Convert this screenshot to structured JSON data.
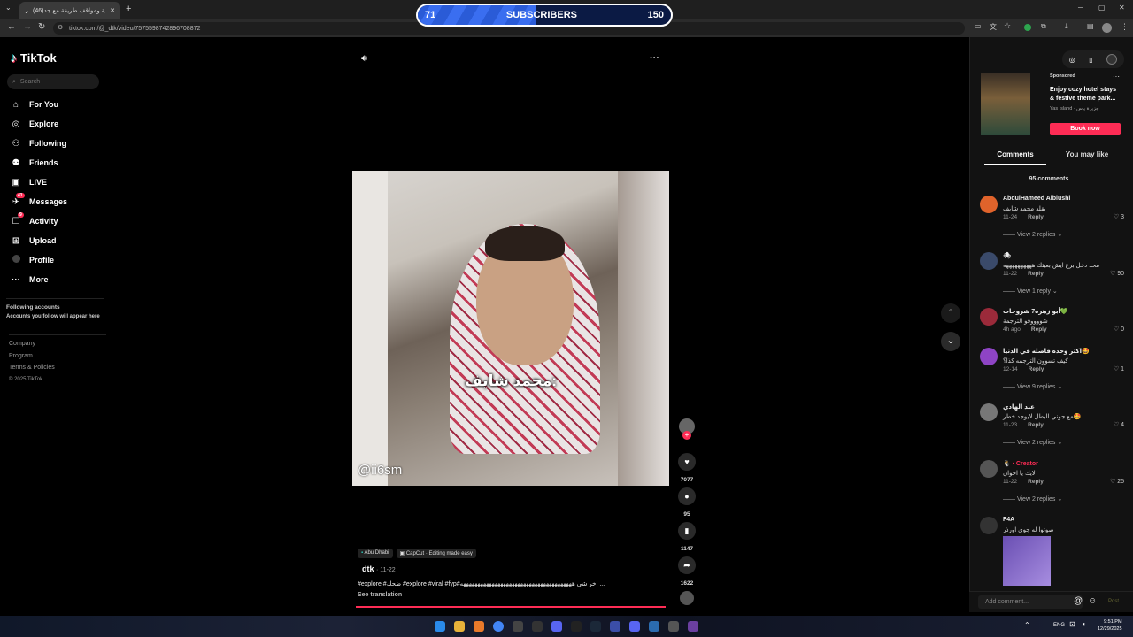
{
  "browser": {
    "tab_title": "(46)اقطاعية ومواقف طريقة مع جد...",
    "url": "tiktok.com/@_dtk/video/7575598742896708872",
    "new_tab": "+"
  },
  "overlay": {
    "left_count": "71",
    "label": "SUBSCRIBERS",
    "right_count": "150",
    "progress_fraction": 0.47
  },
  "sidebar": {
    "logo": "TikTok",
    "search_placeholder": "Search",
    "items": [
      {
        "label": "For You",
        "icon": "home-icon"
      },
      {
        "label": "Explore",
        "icon": "compass-icon"
      },
      {
        "label": "Following",
        "icon": "following-icon"
      },
      {
        "label": "Friends",
        "icon": "friends-icon"
      },
      {
        "label": "LIVE",
        "icon": "live-icon"
      },
      {
        "label": "Messages",
        "icon": "messages-icon",
        "badge": "41"
      },
      {
        "label": "Activity",
        "icon": "activity-icon",
        "badge": "9"
      },
      {
        "label": "Upload",
        "icon": "upload-icon"
      },
      {
        "label": "Profile",
        "icon": "avatar"
      },
      {
        "label": "More",
        "icon": "more-icon"
      }
    ],
    "following_title": "Following accounts",
    "following_sub": "Accounts you follow will appear here",
    "footer": [
      "Company",
      "Program",
      "Terms & Policies",
      "© 2025 TikTok"
    ]
  },
  "video": {
    "caption_overlay": "محمد شايف:",
    "watermark": "@ii6sm",
    "location_tag": "Abu Dhabi",
    "capcut_tag": "CapCut · Editing made easy",
    "author": "_dtk",
    "date": "· 11-22",
    "description": "#explore #ضحك #explore #viral #fyp#اخر شي هههههههههههههههههههههههههههههههههههههههه ...",
    "see_translation": "See translation"
  },
  "actions": {
    "likes": "7077",
    "comments": "95",
    "saves": "1147",
    "shares": "1622"
  },
  "right_panel": {
    "ad_label": "Sponsored",
    "ad_title": "Enjoy cozy hotel stays & festive theme park...",
    "ad_brand": "Yas Island · جزيرة ياس",
    "ad_button": "Book now",
    "tab_comments": "Comments",
    "tab_you_may_like": "You may like",
    "comment_count": "95 comments",
    "comments": [
      {
        "name": "AbdulHameed Alblushi",
        "text": "يقلد محمد شايف",
        "date": "11-24",
        "reply": "Reply",
        "likes": "3",
        "replies": "View 2 replies",
        "color": "#e0632b"
      },
      {
        "name": "🕷",
        "text": "محد دخل برع ايش بعيتك ههههههههههه",
        "date": "11-22",
        "reply": "Reply",
        "likes": "90",
        "replies": "View 1 reply",
        "color": "#3a4a6a"
      },
      {
        "name": "أبو زهره7 شروحات💚",
        "text": "شووووفو الترجمة",
        "date": "4h ago",
        "reply": "Reply",
        "likes": "0",
        "replies": "",
        "color": "#9b2a3a"
      },
      {
        "name": "اكثر وحده فاصله في الدنيا🤩",
        "text": "كيف تسوون الترجمه كذا؟",
        "date": "12-14",
        "reply": "Reply",
        "likes": "1",
        "replies": "View 9 replies",
        "color": "#8e44c4"
      },
      {
        "name": "عبد الهادي",
        "text": "مع جوني البطل لايوجد خطر🤩",
        "date": "11-23",
        "reply": "Reply",
        "likes": "4",
        "replies": "View 2 replies",
        "color": "#777"
      },
      {
        "name": "🐧 · Creator",
        "text": "لايك يا اخوان",
        "date": "11-22",
        "reply": "Reply",
        "likes": "25",
        "replies": "View 2 replies",
        "color": "#555"
      },
      {
        "name": "F4A",
        "text": "صوتوا له جوي اورذر",
        "date": "",
        "reply": "",
        "likes": "",
        "replies": "",
        "color": "#333"
      }
    ],
    "add_comment_placeholder": "Add comment...",
    "post_label": "Post"
  },
  "taskbar": {
    "lang": "ENG",
    "time": "9:51 PM",
    "date": "12/29/2025"
  }
}
